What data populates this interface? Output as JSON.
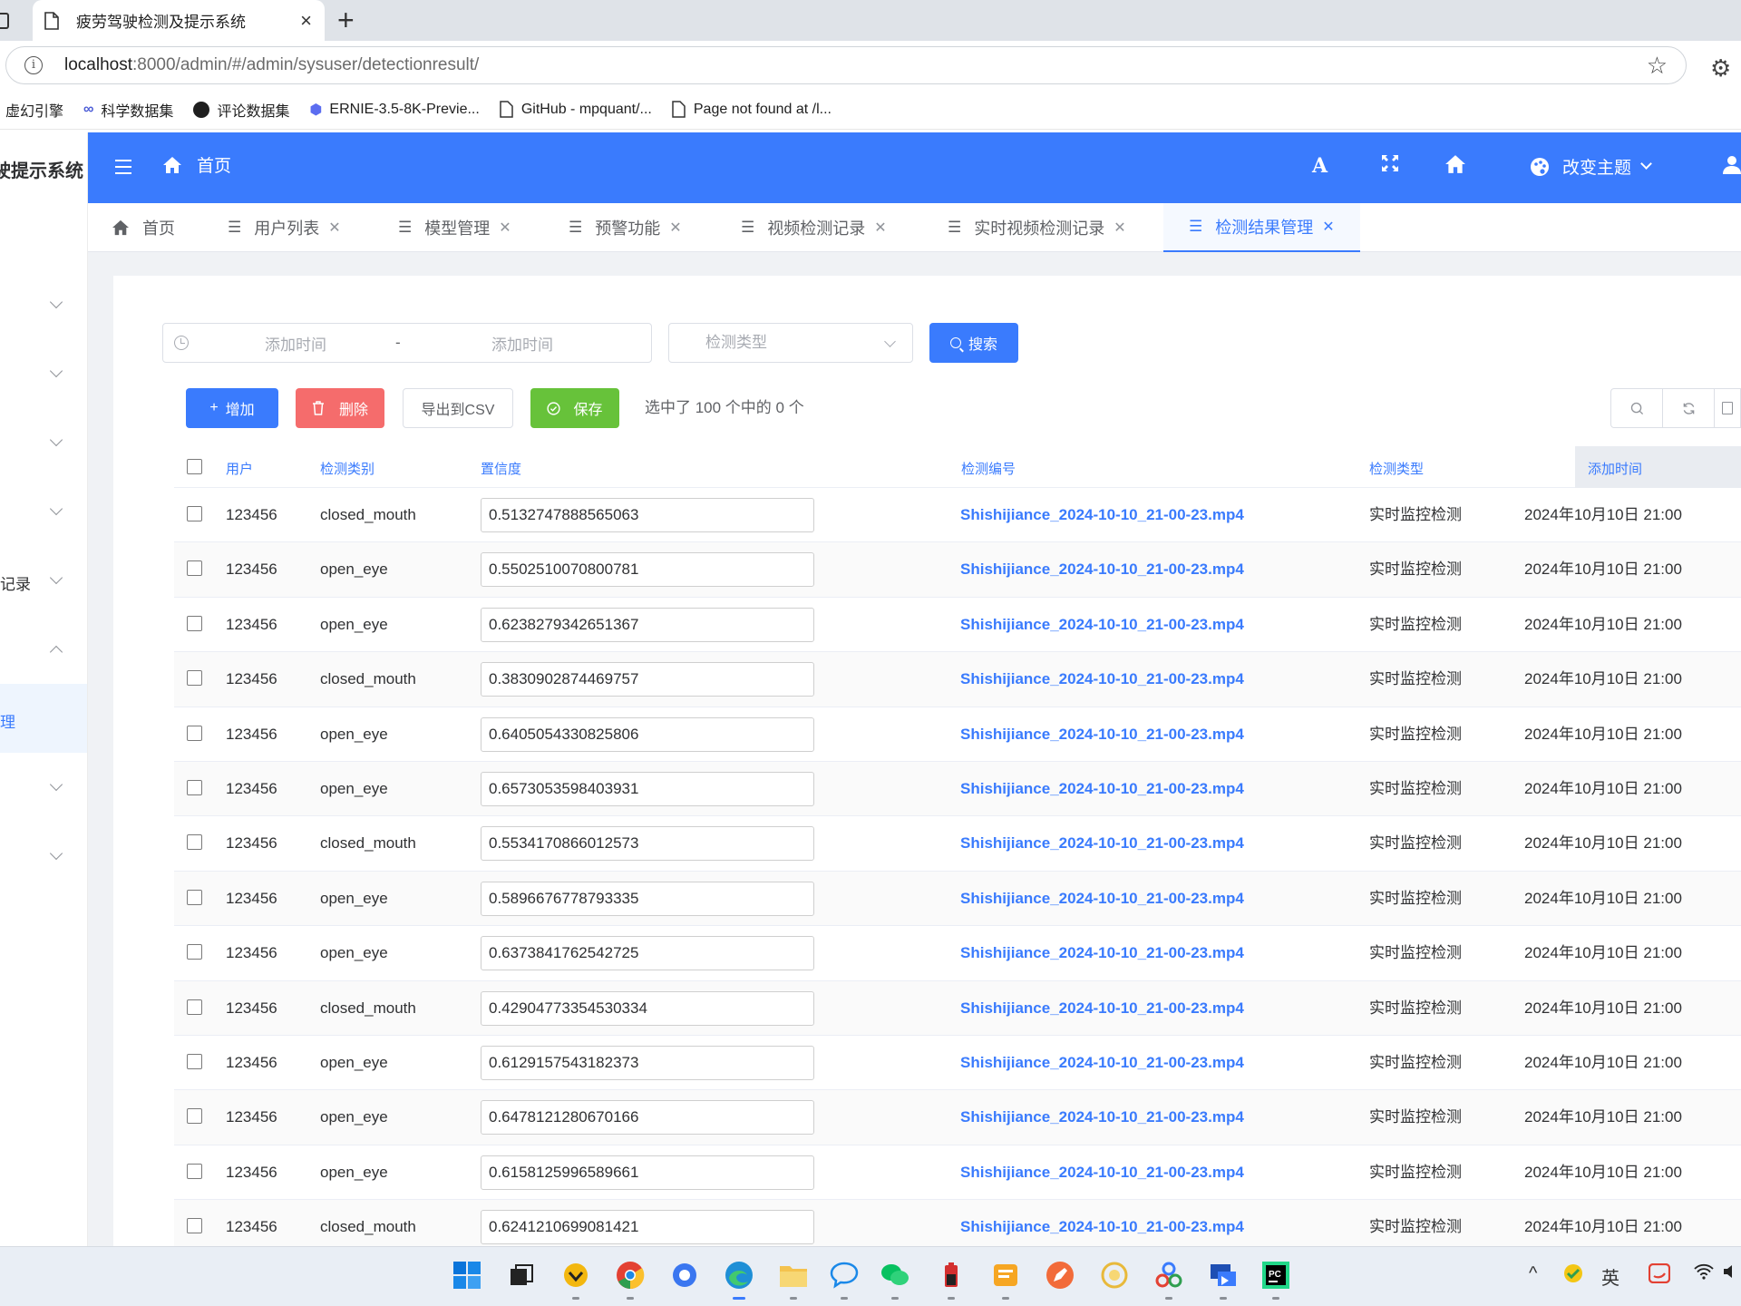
{
  "browser": {
    "tab_title": "疲劳驾驶检测及提示系统",
    "tab_close": "×",
    "new_tab": "+",
    "url_host": "localhost",
    "url_rest": ":8000/admin/#/admin/sysuser/detectionresult/",
    "bookmarks": [
      {
        "label": "虚幻引擎",
        "icon": "none"
      },
      {
        "label": "科学数据集",
        "icon": "infinity-icon"
      },
      {
        "label": "评论数据集",
        "icon": "github-icon"
      },
      {
        "label": "ERNIE-3.5-8K-Previe...",
        "icon": "ernie-icon"
      },
      {
        "label": "GitHub - mpquant/...",
        "icon": "doc-icon"
      },
      {
        "label": "Page not found at /l...",
        "icon": "doc-icon"
      }
    ]
  },
  "sidebar": {
    "title": "驶提示系统",
    "items": [
      {
        "label": "",
        "expanded": false
      },
      {
        "label": "",
        "expanded": false
      },
      {
        "label": "",
        "expanded": false
      },
      {
        "label": "",
        "expanded": false
      },
      {
        "label": "记录",
        "expanded": false
      },
      {
        "label": "",
        "expanded": true
      },
      {
        "label": "理",
        "active": true
      },
      {
        "label": "",
        "expanded": false
      },
      {
        "label": "",
        "expanded": false
      }
    ]
  },
  "header": {
    "home_label": "首页",
    "font_icon_glyph": "A",
    "theme_label": "改变主题"
  },
  "tags": [
    {
      "label": "首页",
      "closable": false,
      "active": false
    },
    {
      "label": "用户列表",
      "closable": true,
      "active": false
    },
    {
      "label": "模型管理",
      "closable": true,
      "active": false
    },
    {
      "label": "预警功能",
      "closable": true,
      "active": false
    },
    {
      "label": "视频检测记录",
      "closable": true,
      "active": false
    },
    {
      "label": "实时视频检测记录",
      "closable": true,
      "active": false
    },
    {
      "label": "检测结果管理",
      "closable": true,
      "active": true
    }
  ],
  "search": {
    "start_placeholder": "添加时间",
    "range_separator": "-",
    "end_placeholder": "添加时间",
    "type_placeholder": "检测类型",
    "search_label": "搜索"
  },
  "toolbar": {
    "add_label": "增加",
    "delete_label": "删除",
    "export_label": "导出到CSV",
    "save_label": "保存",
    "selection_info": "选中了 100 个中的 0 个"
  },
  "table": {
    "columns": [
      "用户",
      "检测类别",
      "置信度",
      "检测编号",
      "检测类型",
      "添加时间"
    ],
    "rows": [
      {
        "user": "123456",
        "category": "closed_mouth",
        "confidence": "0.5132747888565063",
        "code": "Shishijiance_2024-10-10_21-00-23.mp4",
        "type": "实时监控检测",
        "time": "2024年10月10日 21:00"
      },
      {
        "user": "123456",
        "category": "open_eye",
        "confidence": "0.5502510070800781",
        "code": "Shishijiance_2024-10-10_21-00-23.mp4",
        "type": "实时监控检测",
        "time": "2024年10月10日 21:00"
      },
      {
        "user": "123456",
        "category": "open_eye",
        "confidence": "0.6238279342651367",
        "code": "Shishijiance_2024-10-10_21-00-23.mp4",
        "type": "实时监控检测",
        "time": "2024年10月10日 21:00"
      },
      {
        "user": "123456",
        "category": "closed_mouth",
        "confidence": "0.3830902874469757",
        "code": "Shishijiance_2024-10-10_21-00-23.mp4",
        "type": "实时监控检测",
        "time": "2024年10月10日 21:00"
      },
      {
        "user": "123456",
        "category": "open_eye",
        "confidence": "0.6405054330825806",
        "code": "Shishijiance_2024-10-10_21-00-23.mp4",
        "type": "实时监控检测",
        "time": "2024年10月10日 21:00"
      },
      {
        "user": "123456",
        "category": "open_eye",
        "confidence": "0.6573053598403931",
        "code": "Shishijiance_2024-10-10_21-00-23.mp4",
        "type": "实时监控检测",
        "time": "2024年10月10日 21:00"
      },
      {
        "user": "123456",
        "category": "closed_mouth",
        "confidence": "0.5534170866012573",
        "code": "Shishijiance_2024-10-10_21-00-23.mp4",
        "type": "实时监控检测",
        "time": "2024年10月10日 21:00"
      },
      {
        "user": "123456",
        "category": "open_eye",
        "confidence": "0.5896676778793335",
        "code": "Shishijiance_2024-10-10_21-00-23.mp4",
        "type": "实时监控检测",
        "time": "2024年10月10日 21:00"
      },
      {
        "user": "123456",
        "category": "open_eye",
        "confidence": "0.6373841762542725",
        "code": "Shishijiance_2024-10-10_21-00-23.mp4",
        "type": "实时监控检测",
        "time": "2024年10月10日 21:00"
      },
      {
        "user": "123456",
        "category": "closed_mouth",
        "confidence": "0.42904773354530334",
        "code": "Shishijiance_2024-10-10_21-00-23.mp4",
        "type": "实时监控检测",
        "time": "2024年10月10日 21:00"
      },
      {
        "user": "123456",
        "category": "open_eye",
        "confidence": "0.6129157543182373",
        "code": "Shishijiance_2024-10-10_21-00-23.mp4",
        "type": "实时监控检测",
        "time": "2024年10月10日 21:00"
      },
      {
        "user": "123456",
        "category": "open_eye",
        "confidence": "0.6478121280670166",
        "code": "Shishijiance_2024-10-10_21-00-23.mp4",
        "type": "实时监控检测",
        "time": "2024年10月10日 21:00"
      },
      {
        "user": "123456",
        "category": "open_eye",
        "confidence": "0.6158125996589661",
        "code": "Shishijiance_2024-10-10_21-00-23.mp4",
        "type": "实时监控检测",
        "time": "2024年10月10日 21:00"
      },
      {
        "user": "123456",
        "category": "closed_mouth",
        "confidence": "0.6241210699081421",
        "code": "Shishijiance_2024-10-10_21-00-23.mp4",
        "type": "实时监控检测",
        "time": "2024年10月10日 21:00"
      }
    ]
  },
  "taskbar": {
    "apps": [
      "windows-start-icon",
      "task-view-icon",
      "vpn-shield-icon",
      "chrome-icon",
      "signal-icon",
      "edge-icon",
      "file-explorer-icon",
      "chat-bubble-icon",
      "wechat-icon",
      "battery-app-icon",
      "notes-app-icon",
      "pen-app-icon",
      "cloud-app-icon",
      "network-app-icon",
      "remote-desktop-icon",
      "pycharm-icon"
    ],
    "ime_label": "英",
    "colors": {
      "accent": "#3a7bfd",
      "danger": "#f56c6c",
      "success": "#67c23a"
    }
  }
}
